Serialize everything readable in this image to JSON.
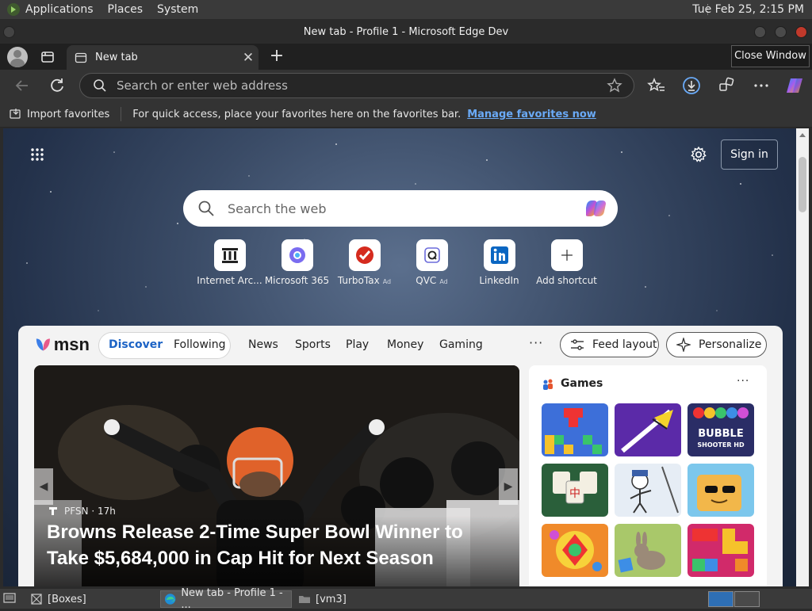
{
  "os_panel": {
    "menus": [
      "Applications",
      "Places",
      "System"
    ],
    "clock": "Tue Feb 25,  2:15 PM"
  },
  "window": {
    "title": "New tab - Profile 1 - Microsoft Edge Dev",
    "tooltip": "Close Window"
  },
  "tabs": {
    "active_label": "New tab",
    "close_glyph": "✕",
    "new_tab_glyph": "+"
  },
  "address_bar": {
    "placeholder": "Search or enter web address"
  },
  "favorites_bar": {
    "import_label": "Import favorites",
    "hint": "For quick access, place your favorites here on the favorites bar.",
    "manage_link": "Manage favorites now"
  },
  "newtab": {
    "sign_in": "Sign in",
    "search_placeholder": "Search the web",
    "shortcuts": [
      {
        "label": "Internet Arc...",
        "ad": "",
        "icon": "archive-icon"
      },
      {
        "label": "Microsoft 365",
        "ad": "",
        "icon": "m365-icon"
      },
      {
        "label": "TurboTax",
        "ad": "Ad",
        "icon": "turbotax-icon"
      },
      {
        "label": "QVC",
        "ad": "Ad",
        "icon": "qvc-icon"
      },
      {
        "label": "LinkedIn",
        "ad": "",
        "icon": "linkedin-icon"
      },
      {
        "label": "Add shortcut",
        "ad": "",
        "icon": "plus-icon"
      }
    ]
  },
  "feed": {
    "logo": "msn",
    "pills": {
      "discover": "Discover",
      "following": "Following"
    },
    "nav": [
      "News",
      "Sports",
      "Play",
      "Money",
      "Gaming"
    ],
    "more": "···",
    "feed_layout": "Feed layout",
    "personalize": "Personalize",
    "hero": {
      "source": "PFSN",
      "age": "· 17h",
      "title": "Browns Release 2-Time Super Bowl Winner to Take $5,684,000 in Cap Hit for Next Season"
    },
    "games": {
      "title": "Games",
      "more": "···",
      "tiles": [
        "Tetris blocks",
        "Paper plane",
        "Bubble Shooter HD",
        "Mahjong",
        "Stickman",
        "Block character",
        "Jewel match",
        "Bunny puzzle",
        "Block puzzle"
      ]
    }
  },
  "taskbar": {
    "items": [
      "[Boxes]",
      "New tab - Profile 1 - ...",
      "[vm3]"
    ]
  },
  "colors": {
    "link": "#6aaaf7",
    "discover": "#1c63c5",
    "close_button": "#c0392b"
  }
}
